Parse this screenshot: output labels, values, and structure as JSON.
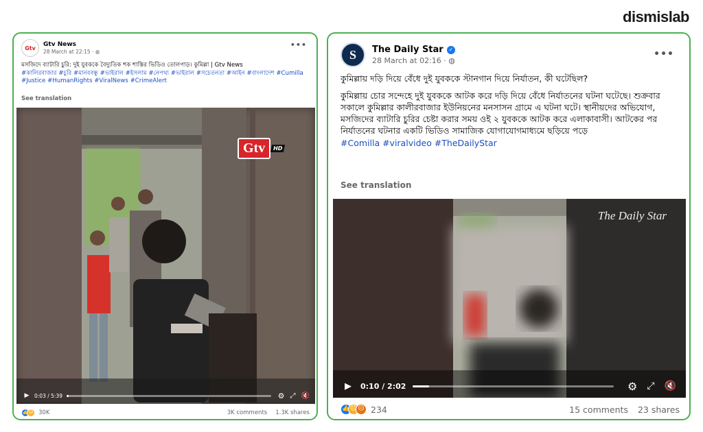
{
  "brand": "dismislab",
  "post1": {
    "page_name": "Gtv News",
    "timestamp": "28 March at 22:15 · ",
    "avatar_text": "Gtv",
    "body": "মসজিদে ব্যাটারি চুরি: দুই যুবককে বৈদ্যুতিক শক শাস্তির ভিডিও তোলপাড়। কুমিল্লা | Gtv News",
    "hashtags": "#কালিরবাজার #চুরি #মানববন্ধু #ভাইরাল #ইসলাম #নেপথ্য #ভাইরাল #সচেতনতা #আইন #বাংলাদেশ  #Cumilla #Justice #HumanRights  #ViralNews #CrimeAlert",
    "see_translation": "See translation",
    "watermark": "Gtv",
    "watermark_hd": "HD",
    "time": "0:03 / 5:39",
    "progress": 0.01,
    "reactions": "30K",
    "comments": "3K comments",
    "shares": "1.3K shares"
  },
  "post2": {
    "page_name": "The Daily Star",
    "timestamp": "28 March at 02:16 · ",
    "avatar_text": "S",
    "headline": "কুমিল্লায় দড়ি দিয়ে বেঁধে দুই যুবককে স্টানগান দিয়ে নির্যাতন, কী ঘটেছিল?",
    "body": "কুমিল্লায় চোর সন্দেহে দুই যুবককে আটক করে দড়ি দিয়ে বেঁধে নির্যাতনের ঘটনা ঘটেছে। শুক্রবার সকালে কুমিল্লার কালীরবাজার ইউনিয়নের মনসাসন গ্রামে এ ঘটনা ঘটে। স্থানীয়দের অভিযোগ, মসজিদের ব্যাটারি চুরির চেষ্টা করার সময় ওই ২ যুবককে আটক করে এলাকাবাসী। আটকের পর নির্যাতনের ঘটনার একটি ভিডিও সামাজিক যোগাযোগমাধ্যমে ছড়িয়ে পড়ে",
    "hashtags": "#Comilla #viralvideo #TheDailyStar",
    "see_translation": "See translation",
    "watermark": "The Daily Star",
    "time": "0:10 / 2:02",
    "progress": 0.08,
    "reactions": "234",
    "comments": "15 comments",
    "shares": "23 shares"
  },
  "colors": {
    "border": "#4caf50",
    "hashtag": "#1b4dc4",
    "verified": "#1877f2"
  }
}
